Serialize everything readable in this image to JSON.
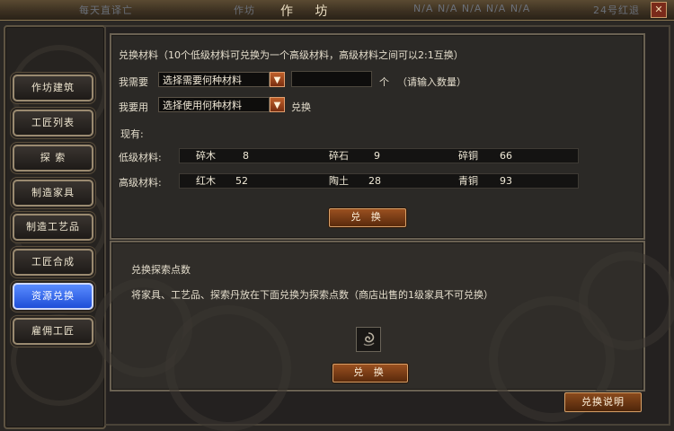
{
  "window": {
    "title": "作 坊",
    "ghost_left": "每天直译亡",
    "ghost_mid": "作坊",
    "ghost_na": "N/A  N/A  N/A  N/A  N/A",
    "ghost_right": "24号红退",
    "close_icon": "close-icon"
  },
  "sidebar": {
    "items": [
      {
        "label": "作坊建筑"
      },
      {
        "label": "工匠列表"
      },
      {
        "label": "探  索"
      },
      {
        "label": "制造家具"
      },
      {
        "label": "制造工艺品"
      },
      {
        "label": "工匠合成"
      },
      {
        "label": "资源兑换",
        "active": true
      },
      {
        "label": "雇佣工匠"
      }
    ]
  },
  "exchange": {
    "header": "兑换材料（10个低级材料可兑换为一个高级材料，高级材料之间可以2:1互换）",
    "need_label": "我需要",
    "need_select": "选择需要何种材料",
    "qty_unit": "个",
    "qty_hint": "（请输入数量）",
    "use_label": "我要用",
    "use_select": "选择使用何种材料",
    "use_suffix": "兑换",
    "have_label": "现有:",
    "low_label": "低级材料:",
    "high_label": "高级材料:",
    "low": [
      {
        "name": "碎木",
        "count": "8"
      },
      {
        "name": "碎石",
        "count": "9"
      },
      {
        "name": "碎铜",
        "count": "66"
      }
    ],
    "high": [
      {
        "name": "红木",
        "count": "52"
      },
      {
        "name": "陶土",
        "count": "28"
      },
      {
        "name": "青铜",
        "count": "93"
      }
    ],
    "button": "兑 换"
  },
  "explore": {
    "header": "兑换探索点数",
    "desc": "将家具、工艺品、探索丹放在下面兑换为探索点数（商店出售的1级家具不可兑换）",
    "slot_icon": "swirl-icon",
    "button": "兑 换"
  },
  "help_button": "兑换说明",
  "colors": {
    "active_tab": "#1e4ed8",
    "button_brown": "#7a3a14",
    "panel_bg": "#2b2926"
  }
}
